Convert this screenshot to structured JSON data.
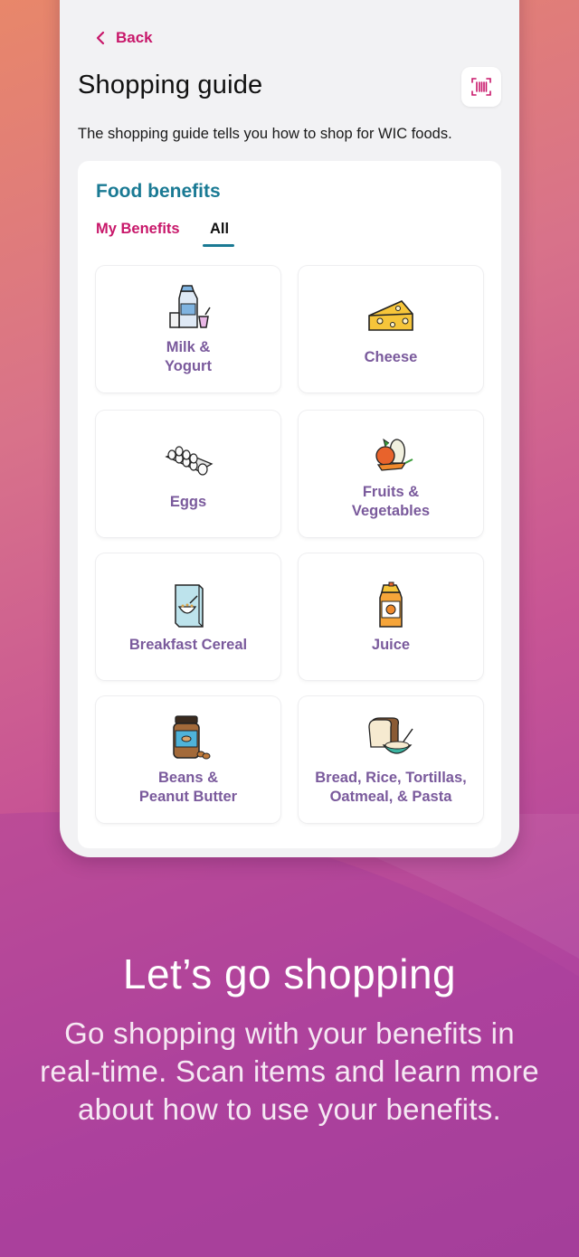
{
  "nav": {
    "back_label": "Back"
  },
  "header": {
    "title": "Shopping guide",
    "scan_icon": "barcode-scan-icon"
  },
  "description": "The shopping guide tells you how to shop for WIC foods.",
  "food_benefits": {
    "title": "Food benefits",
    "tabs": [
      {
        "label": "My Benefits",
        "active": false
      },
      {
        "label": "All",
        "active": true
      }
    ],
    "categories": [
      {
        "label": "Milk &\nYogurt",
        "icon": "milk-yogurt-icon"
      },
      {
        "label": "Cheese",
        "icon": "cheese-icon"
      },
      {
        "label": "Eggs",
        "icon": "eggs-icon"
      },
      {
        "label": "Fruits &\nVegetables",
        "icon": "fruits-vegetables-icon"
      },
      {
        "label": "Breakfast Cereal",
        "icon": "cereal-icon"
      },
      {
        "label": "Juice",
        "icon": "juice-icon"
      },
      {
        "label": "Beans &\nPeanut Butter",
        "icon": "beans-peanut-butter-icon"
      },
      {
        "label": "Bread, Rice, Tortillas,\nOatmeal, & Pasta",
        "icon": "grains-icon"
      }
    ]
  },
  "promo": {
    "headline": "Let’s go shopping",
    "body": "Go shopping with your benefits in real-time. Scan items and learn more about how to use your benefits."
  },
  "colors": {
    "accent_pink": "#c8176a",
    "accent_teal": "#1a7a94",
    "tile_label": "#7a5a9c"
  }
}
